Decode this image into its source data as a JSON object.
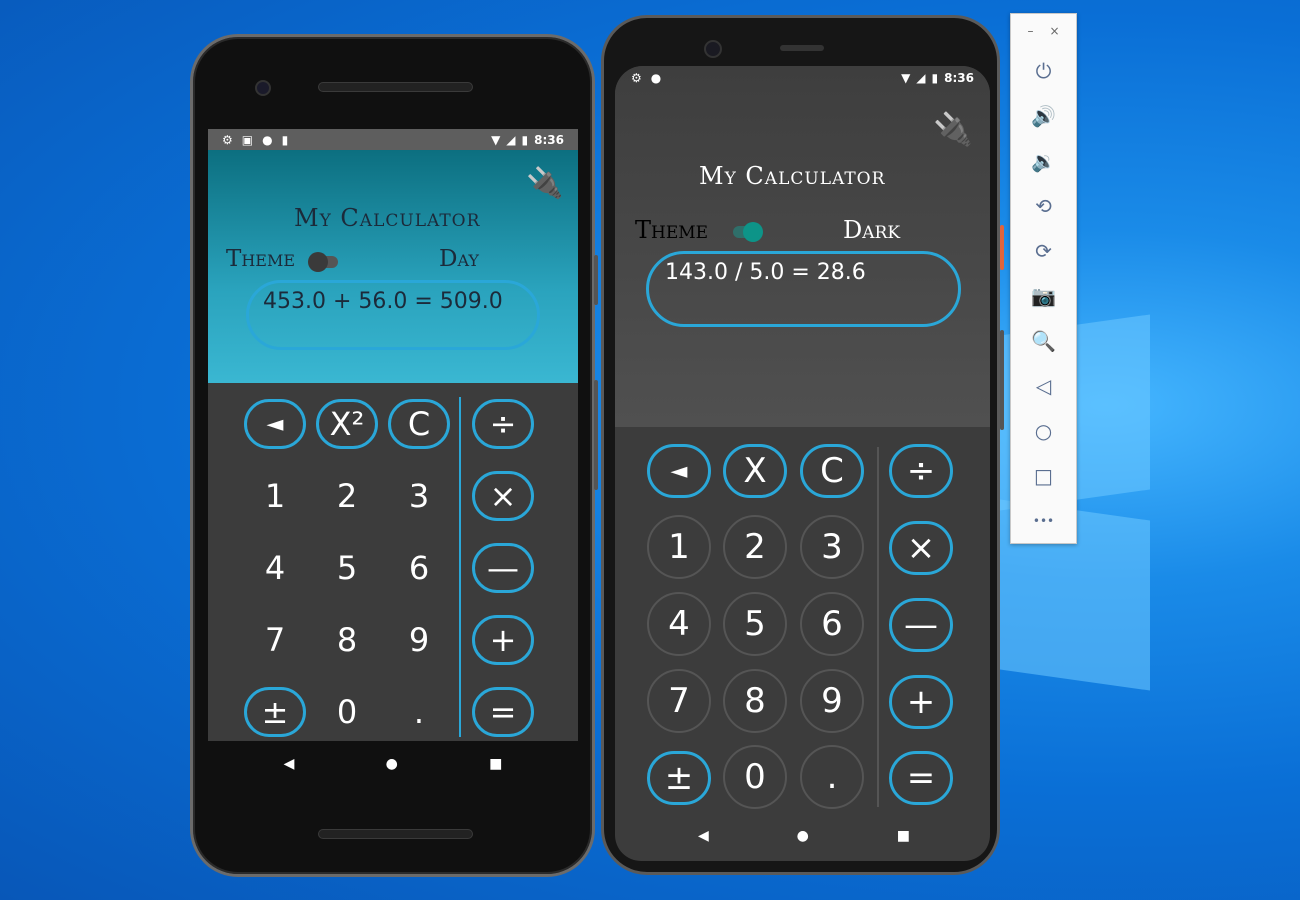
{
  "phone_day": {
    "status": {
      "time": "8:36"
    },
    "app_title": "My Calculator",
    "theme_label": "Theme",
    "mode_label": "Day",
    "display_text": "453.0 + 56.0 = 509.0",
    "keys": {
      "backspace": "◄",
      "square": "X²",
      "clear": "C",
      "divide": "÷",
      "n1": "1",
      "n2": "2",
      "n3": "3",
      "multiply": "×",
      "n4": "4",
      "n5": "5",
      "n6": "6",
      "minus": "—",
      "n7": "7",
      "n8": "8",
      "n9": "9",
      "plus": "+",
      "negate": "±",
      "n0": "0",
      "dot": ".",
      "equals": "="
    }
  },
  "phone_dark": {
    "status": {
      "time": "8:36"
    },
    "app_title": "My Calculator",
    "theme_label": "Theme",
    "mode_label": "Dark",
    "display_text": "143.0 / 5.0 = 28.6",
    "keys": {
      "backspace": "◄",
      "square": "X",
      "clear": "C",
      "divide": "÷",
      "n1": "1",
      "n2": "2",
      "n3": "3",
      "multiply": "×",
      "n4": "4",
      "n5": "5",
      "n6": "6",
      "minus": "—",
      "n7": "7",
      "n8": "8",
      "n9": "9",
      "plus": "+",
      "negate": "±",
      "n0": "0",
      "dot": ".",
      "equals": "="
    }
  },
  "navbar": {
    "back": "◀",
    "home": "●",
    "recents": "■"
  },
  "toolbar": {
    "minimize": "–",
    "close": "×",
    "items": [
      {
        "name": "power-icon",
        "glyph": "⏻"
      },
      {
        "name": "volume-up-icon",
        "glyph": "🔊"
      },
      {
        "name": "volume-down-icon",
        "glyph": "🔉"
      },
      {
        "name": "rotate-left-icon",
        "glyph": "⟲"
      },
      {
        "name": "rotate-right-icon",
        "glyph": "⟳"
      },
      {
        "name": "camera-icon",
        "glyph": "📷"
      },
      {
        "name": "zoom-icon",
        "glyph": "🔍"
      },
      {
        "name": "back-icon",
        "glyph": "◁"
      },
      {
        "name": "home-icon",
        "glyph": "○"
      },
      {
        "name": "overview-icon",
        "glyph": "□"
      },
      {
        "name": "more-icon",
        "glyph": "•••"
      }
    ]
  },
  "colors": {
    "accent": "#2aa7d8",
    "day_top": "#0c6f80",
    "day_bottom": "#3ab7d2",
    "dark_bg": "#3c3c3c",
    "toggle_on": "#0d9488"
  }
}
